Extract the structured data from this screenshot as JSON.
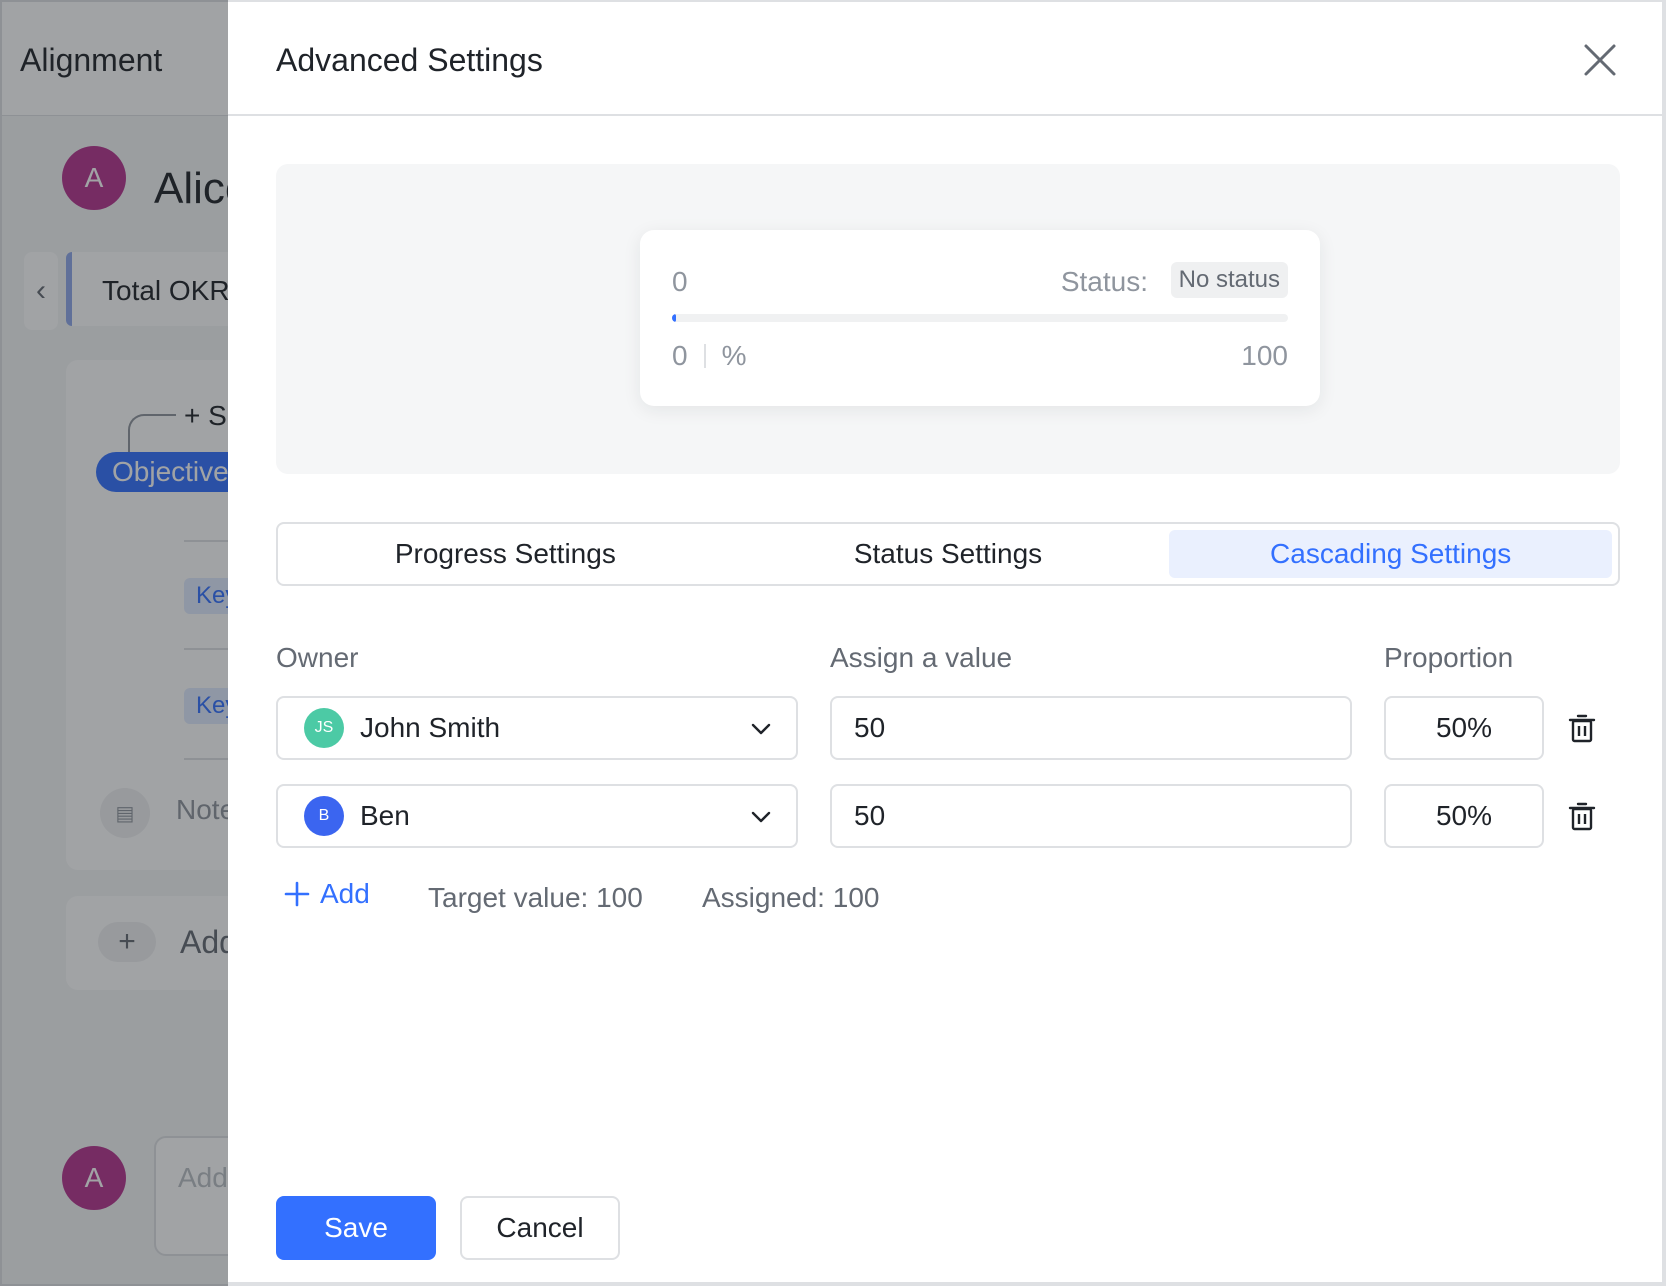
{
  "background": {
    "page_title": "Alignment",
    "avatar_letter": "A",
    "user_name": "Alice",
    "okr_tab": "Total OKRs",
    "sub_label": "+ S",
    "objective_label": "Objective",
    "kr_label": "Key",
    "note_placeholder": "Note",
    "add_label": "Add",
    "comment_placeholder": "Add"
  },
  "drawer": {
    "title": "Advanced Settings",
    "close_icon": "close-icon"
  },
  "preview": {
    "current_value": "0",
    "status_label": "Status:",
    "status_badge": "No status",
    "progress_fraction": 0,
    "min_value": "0",
    "unit": "%",
    "max_value": "100"
  },
  "tabs": [
    {
      "label": "Progress Settings",
      "active": false
    },
    {
      "label": "Status Settings",
      "active": false
    },
    {
      "label": "Cascading Settings",
      "active": true
    }
  ],
  "table": {
    "owner_label": "Owner",
    "value_label": "Assign a value",
    "proportion_label": "Proportion",
    "rows": [
      {
        "initials": "JS",
        "name": "John Smith",
        "avatar_color": "#4ccaa5",
        "value": "50",
        "proportion": "50%"
      },
      {
        "initials": "B",
        "name": "Ben",
        "avatar_color": "#3b65f0",
        "value": "50",
        "proportion": "50%"
      }
    ]
  },
  "footer": {
    "add_label": "Add",
    "target_text": "Target value: 100",
    "assigned_text": "Assigned: 100"
  },
  "buttons": {
    "save": "Save",
    "cancel": "Cancel"
  },
  "colors": {
    "accent": "#3370ff",
    "active_tab_bg": "#eaf0fe",
    "border": "#dee0e3"
  }
}
